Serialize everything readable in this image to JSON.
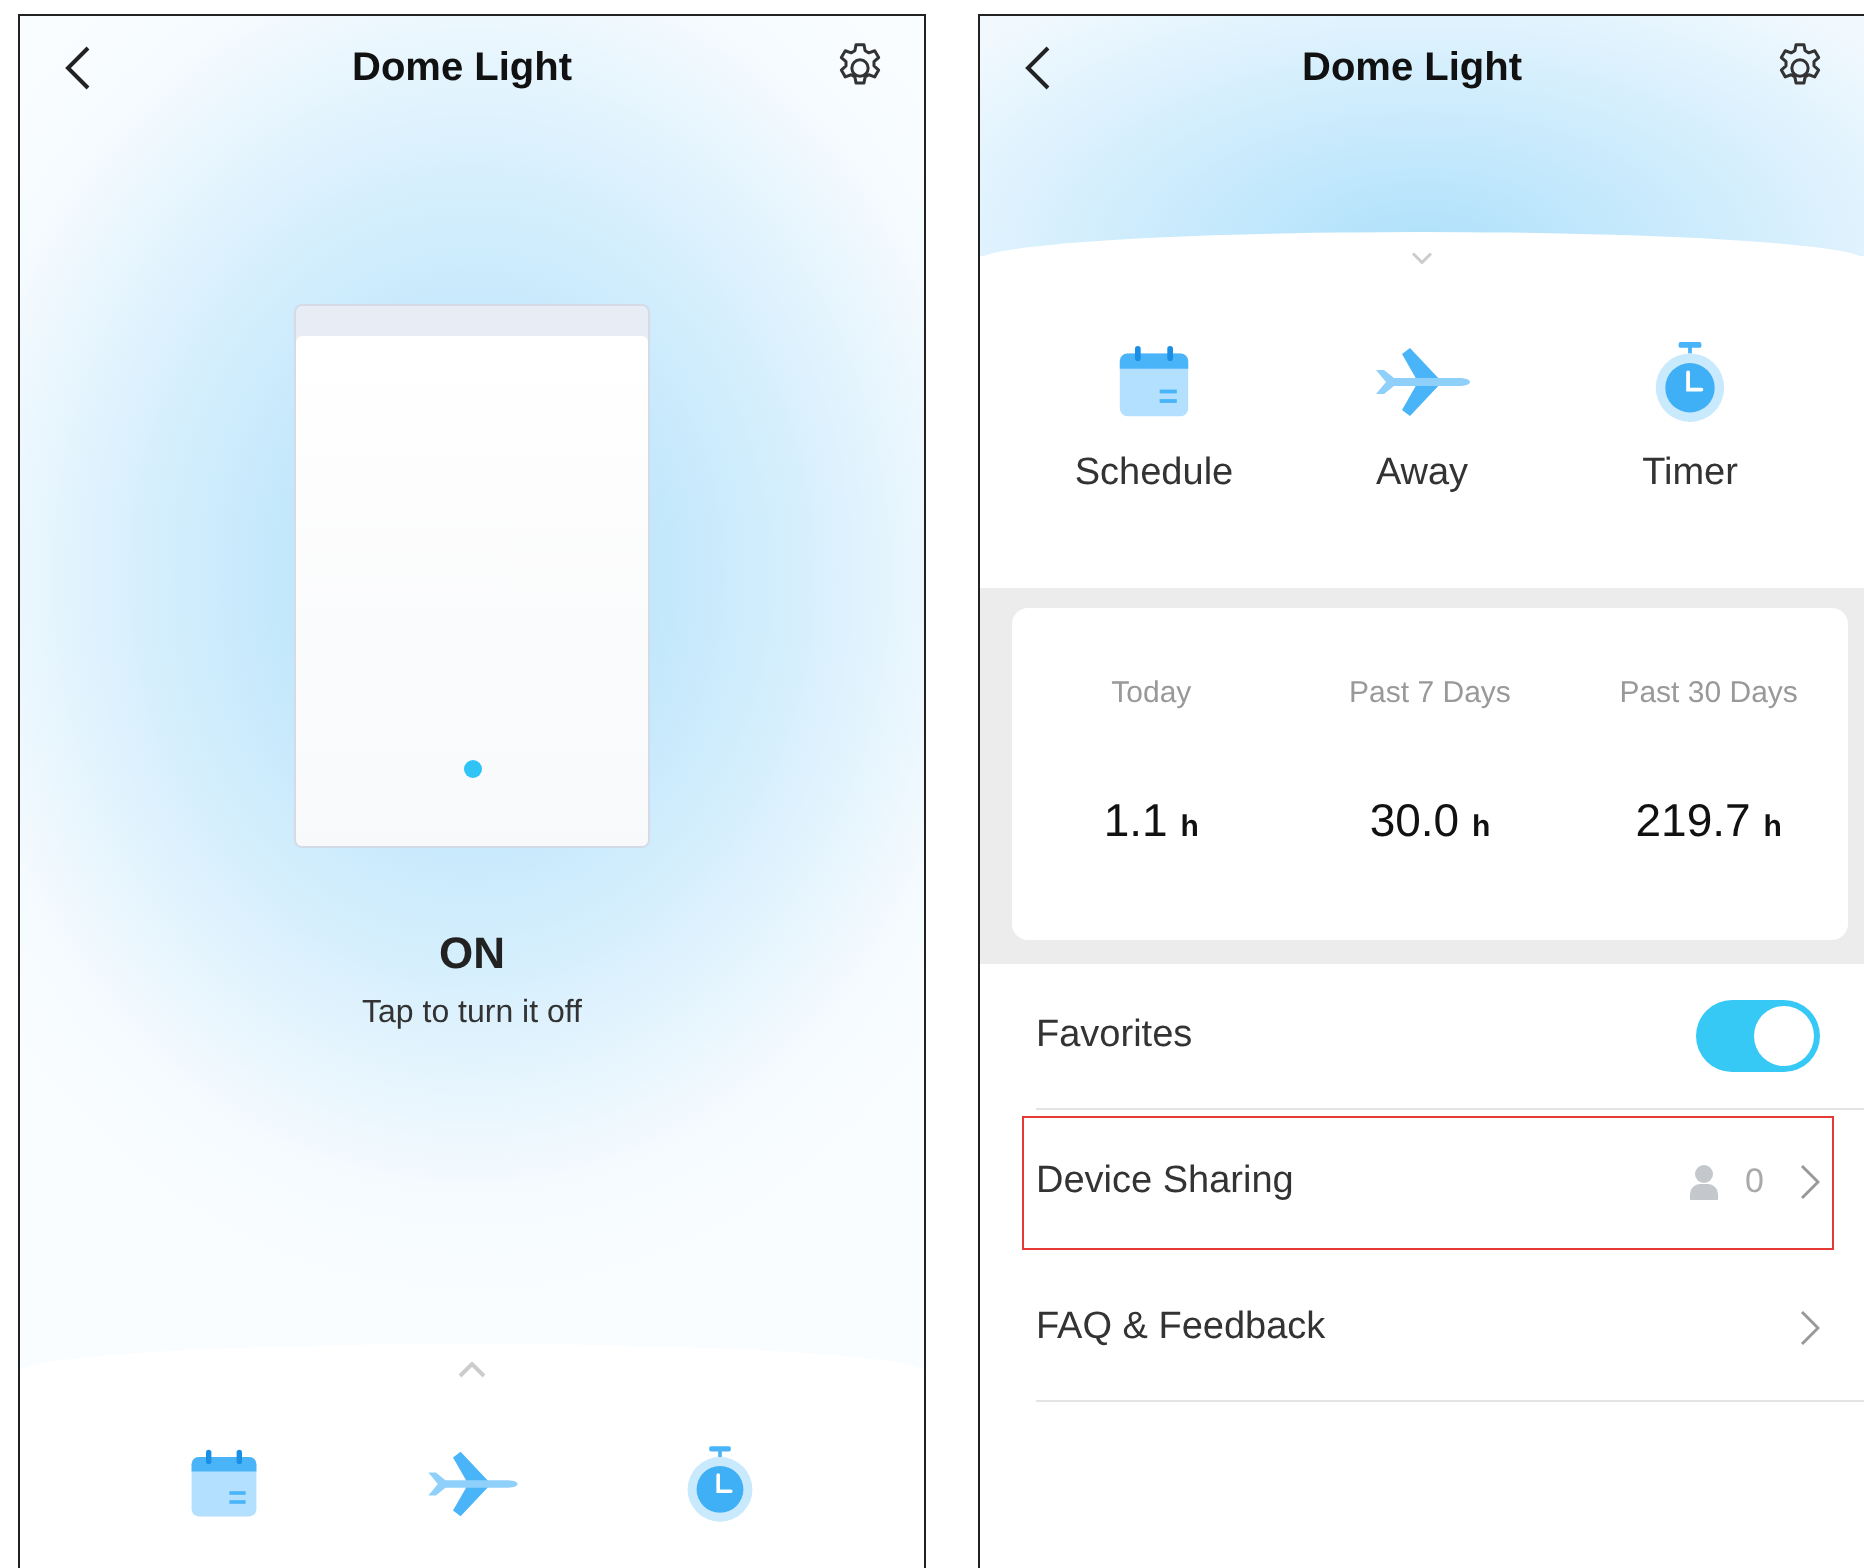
{
  "switch_screen": {
    "title": "Dome Light",
    "power": {
      "on": true,
      "label": "ON",
      "hint": "Tap to turn it off"
    },
    "features": [
      {
        "kind": "schedule"
      },
      {
        "kind": "away"
      },
      {
        "kind": "timer"
      }
    ]
  },
  "details_screen": {
    "title": "Dome Light",
    "features": [
      {
        "kind": "schedule",
        "label": "Schedule"
      },
      {
        "kind": "away",
        "label": "Away"
      },
      {
        "kind": "timer",
        "label": "Timer"
      }
    ],
    "usage": [
      {
        "period": "Today",
        "value": "1.1",
        "unit": "h"
      },
      {
        "period": "Past 7 Days",
        "value": "30.0",
        "unit": "h"
      },
      {
        "period": "Past 30 Days",
        "value": "219.7",
        "unit": "h"
      }
    ],
    "settings": [
      {
        "kind": "toggle",
        "label": "Favorites",
        "on": true,
        "highlighted": false
      },
      {
        "kind": "link",
        "label": "Device Sharing",
        "count": "0",
        "highlighted": true
      },
      {
        "kind": "link",
        "label": "FAQ & Feedback",
        "highlighted": false
      }
    ]
  }
}
